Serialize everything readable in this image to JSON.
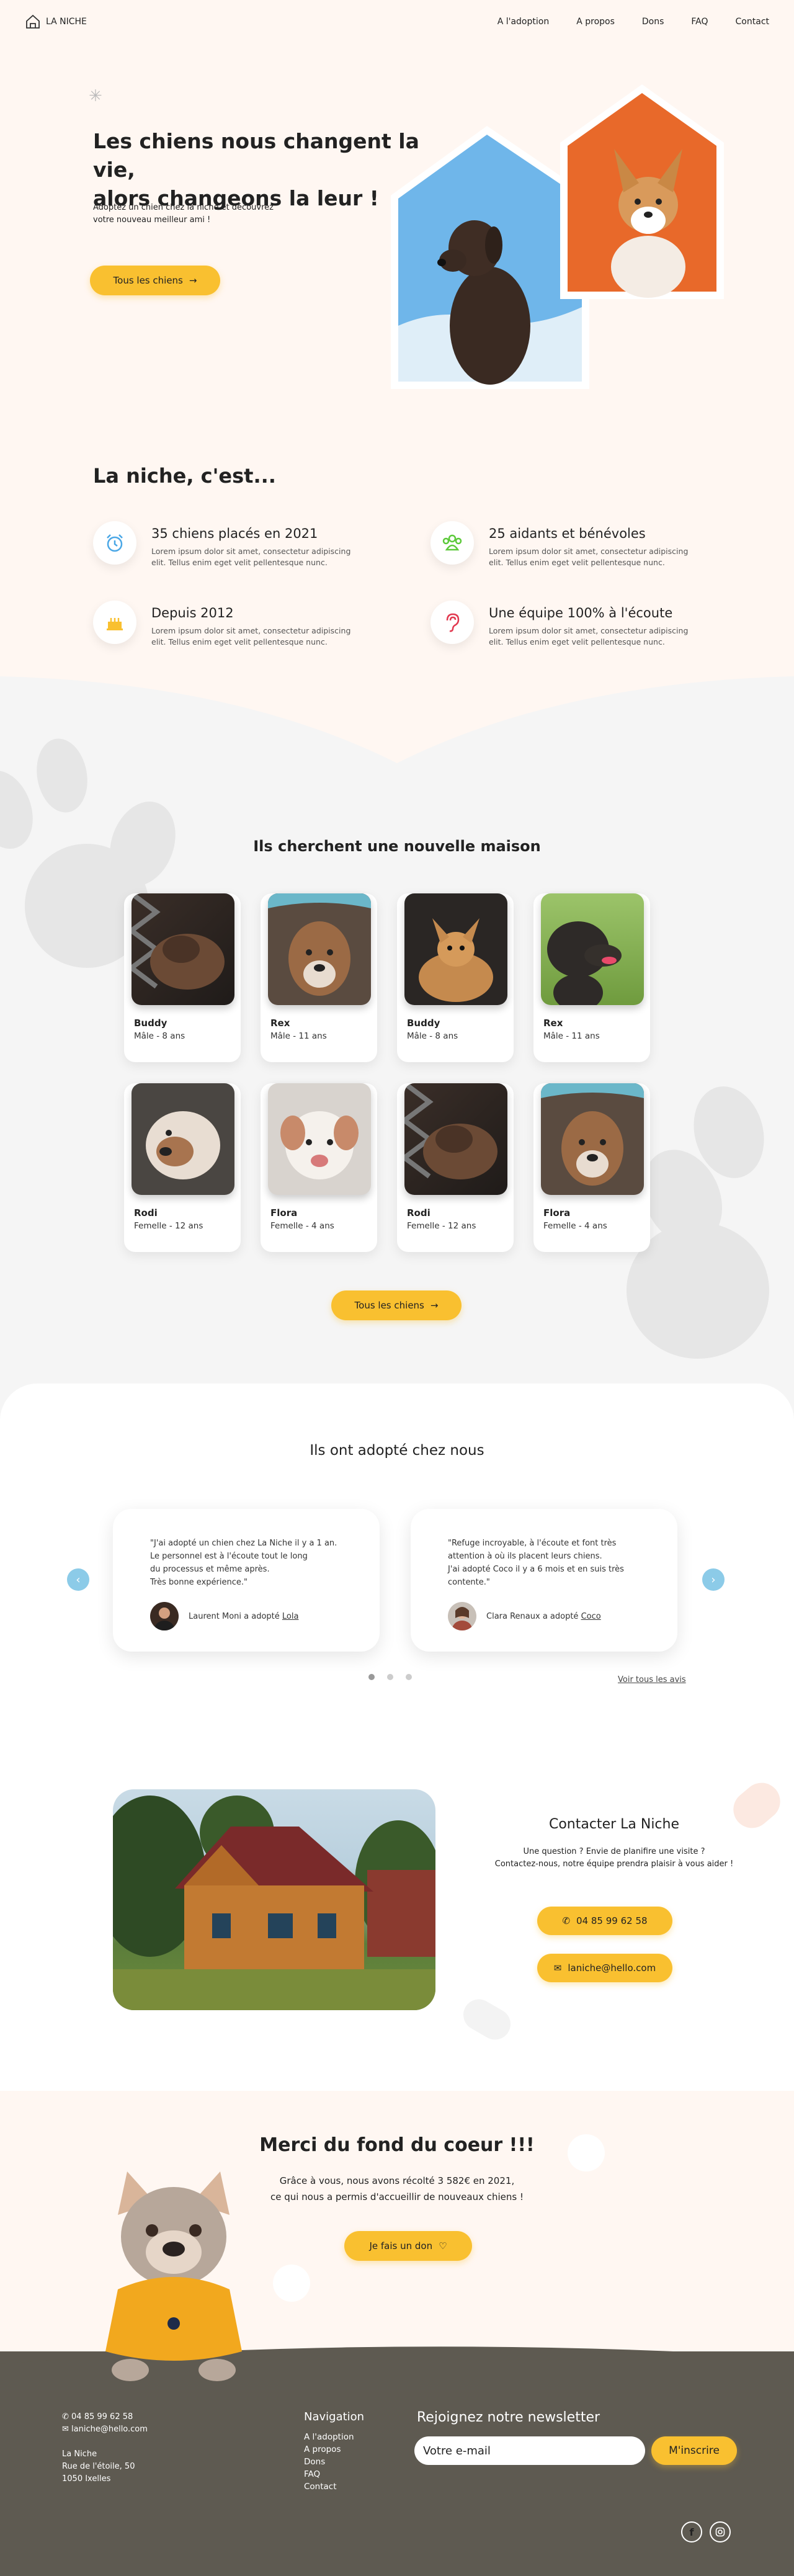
{
  "nav": {
    "logo": "LA NICHE",
    "items": [
      "A l'adoption",
      "A propos",
      "Dons",
      "FAQ",
      "Contact"
    ]
  },
  "hero": {
    "title_line1": "Les chiens nous changent la vie,",
    "title_line2": "alors changeons la leur !",
    "subtitle_line1": "Adoptez un chien chez la niche et découvrez",
    "subtitle_line2": "votre nouveau meilleur ami !",
    "button": "Tous les chiens",
    "arrow": "→"
  },
  "features": {
    "title": "La niche, c'est...",
    "items": [
      {
        "icon": "alarm-clock-icon",
        "title": "35 chiens placés en 2021",
        "text_line1": "Lorem ipsum dolor sit amet, consectetur adipiscing",
        "text_line2": "elit. Tellus enim eget velit pellentesque nunc."
      },
      {
        "icon": "people-icon",
        "title": "25 aidants et bénévoles",
        "text_line1": "Lorem ipsum dolor sit amet, consectetur adipiscing",
        "text_line2": "elit. Tellus enim eget velit pellentesque nunc."
      },
      {
        "icon": "cake-icon",
        "title": "Depuis 2012",
        "text_line1": "Lorem ipsum dolor sit amet, consectetur adipiscing",
        "text_line2": "elit. Tellus enim eget velit pellentesque nunc."
      },
      {
        "icon": "ear-icon",
        "title": "Une équipe 100% à l'écoute",
        "text_line1": "Lorem ipsum dolor sit amet, consectetur adipiscing",
        "text_line2": "elit. Tellus enim eget velit pellentesque nunc."
      }
    ]
  },
  "dogs": {
    "title": "Ils cherchent une nouvelle maison",
    "items": [
      {
        "name": "Buddy",
        "age": "Mâle - 8 ans"
      },
      {
        "name": "Rex",
        "age": "Mâle - 11 ans"
      },
      {
        "name": "Buddy",
        "age": "Mâle - 8 ans"
      },
      {
        "name": "Rex",
        "age": "Mâle - 11 ans"
      },
      {
        "name": "Rodi",
        "age": "Femelle - 12 ans"
      },
      {
        "name": "Flora",
        "age": "Femelle - 4 ans"
      },
      {
        "name": "Rodi",
        "age": "Femelle - 12 ans"
      },
      {
        "name": "Flora",
        "age": "Femelle - 4 ans"
      }
    ],
    "button": "Tous les chiens"
  },
  "testimonials": {
    "title": "Ils ont adopté chez nous",
    "items": [
      {
        "q1": "\"J'ai adopté un chien chez La Niche il y a 1 an.",
        "q2": "Le personnel est à l'écoute tout le long",
        "q3": "du processus et même après.",
        "q4": "Très bonne expérience.\"",
        "who": "Laurent Moni a adopté ",
        "dog": "Lola"
      },
      {
        "q1": "\"Refuge incroyable, à l'écoute et font très",
        "q2": "attention à où ils placent leurs chiens.",
        "q3": "J'ai adopté Coco il y a 6 mois et en suis très",
        "q4": "contente.\"",
        "who": "Clara Renaux a adopté ",
        "dog": "Coco"
      }
    ],
    "see_all": "Voir tous les avis",
    "colors": {
      "arrow": "#8ccbe8"
    }
  },
  "contact": {
    "title": "Contacter La Niche",
    "line1": "Une question ? Envie de planifire une visite ?",
    "line2": "Contactez-nous, notre équipe prendra plaisir à vous aider !",
    "phone": "04 85 99 62 58",
    "email": "laniche@hello.com"
  },
  "donate": {
    "title": "Merci du fond du coeur !!!",
    "line1": "Grâce à vous, nous avons récolté 3 582€ en 2021,",
    "line2": "ce qui nous a permis d'accueillir de nouveaux chiens !",
    "button": "Je fais un don"
  },
  "footer": {
    "phone": "04 85 99 62 58",
    "email": "laniche@hello.com",
    "addr1": "La Niche",
    "addr2": "Rue de l'étoile, 50",
    "addr3": "1050 Ixelles",
    "nav_title": "Navigation",
    "nav_items": [
      "A l'adoption",
      "A propos",
      "Dons",
      "FAQ",
      "Contact"
    ],
    "newsletter_title": "Rejoignez notre newsletter",
    "newsletter_placeholder": "Votre e-mail",
    "newsletter_button": "M'inscrire"
  },
  "colors": {
    "accent": "#f9c030",
    "footer": "#5e5a51",
    "sky": "#6fb6ea",
    "orange": "#e8692a"
  }
}
